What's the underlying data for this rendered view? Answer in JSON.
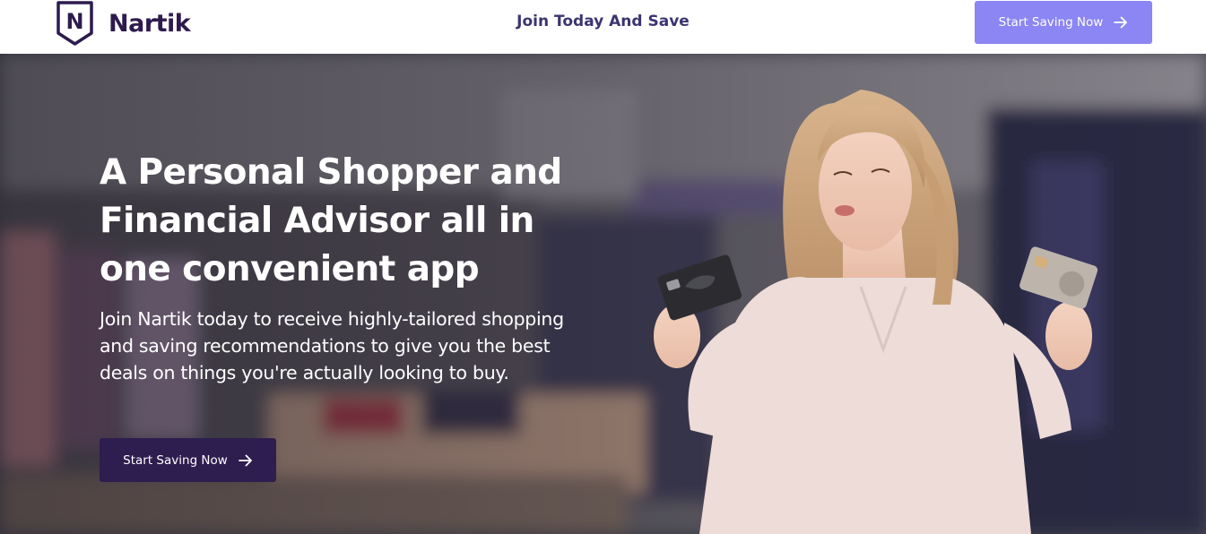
{
  "brand": {
    "name": "Nartik",
    "logo_letter": "N",
    "color": "#2d1b4e"
  },
  "header": {
    "tagline": "Join Today And Save",
    "cta_label": "Start Saving Now",
    "cta_color": "#8b86f3"
  },
  "hero": {
    "title": "A Personal Shopper and Financial Advisor all in one convenient app",
    "subtitle": "Join Nartik today to receive highly-tailored shopping and saving recommendations to give you the best deals on things you're actually looking to buy.",
    "cta_label": "Start Saving Now",
    "cta_color": "#2e1d4f"
  },
  "icons": {
    "cta_arrow": "arrow-right-icon",
    "logo": "shield-icon"
  }
}
